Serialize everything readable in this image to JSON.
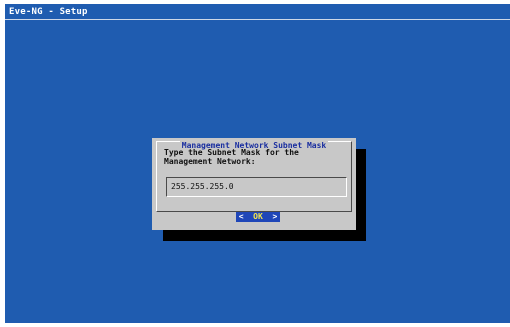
{
  "backtitle": "Eve-NG - Setup",
  "dialog": {
    "title": "Management Network Subnet Mask",
    "prompt": "Type the Subnet Mask for the\nManagement Network:",
    "input_value": "255.255.255.0",
    "button": {
      "left": "<",
      "label": "OK",
      "right": ">"
    }
  },
  "colors": {
    "background": "#1f5cb0",
    "dialog": "#c8c8c8",
    "title_text": "#1a2fa0",
    "button_bg": "#1f46b8",
    "button_label": "#f6e84a"
  }
}
